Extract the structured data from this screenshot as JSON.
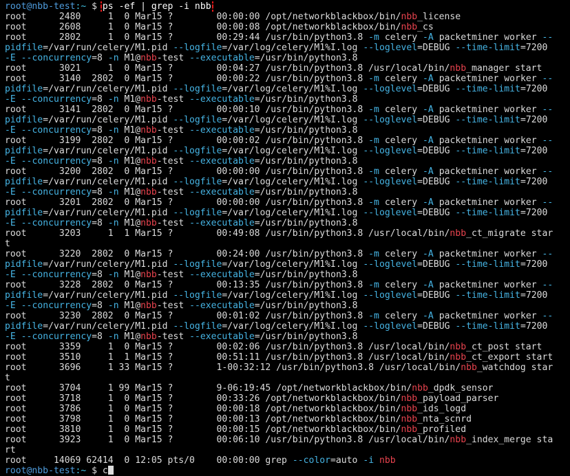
{
  "prompt": {
    "user_host": "root@nbb-test",
    "path": ":~",
    "symbol": " $ ",
    "command": "ps -ef | grep -i nbb"
  },
  "lines": [
    [
      [
        "t",
        "root      2480     1  0 Mar15 ?        00:00:00 /opt/networkblackbox/bin/"
      ],
      [
        "h",
        "nbb"
      ],
      [
        "t",
        "_license"
      ]
    ],
    [
      [
        "t",
        "root      2608     1  0 Mar15 ?        00:00:08 /opt/networkblackbox/bin/"
      ],
      [
        "h",
        "nbb"
      ],
      [
        "t",
        "_cs"
      ]
    ],
    [
      [
        "t",
        "root      2802     1  0 Mar15 ?        00:29:44 /usr/bin/python3.8 "
      ],
      [
        "o",
        "-m"
      ],
      [
        "t",
        " celery "
      ],
      [
        "o",
        "-A"
      ],
      [
        "t",
        " packetminer worker "
      ],
      [
        "o",
        "--"
      ]
    ],
    [
      [
        "o",
        "pidfile"
      ],
      [
        "t",
        "=/var/run/celery/M1.pid "
      ],
      [
        "o",
        "--logfile"
      ],
      [
        "t",
        "=/var/log/celery/M1%I.log "
      ],
      [
        "o",
        "--loglevel"
      ],
      [
        "t",
        "=DEBUG "
      ],
      [
        "o",
        "--time-limit"
      ],
      [
        "t",
        "=7200"
      ]
    ],
    [
      [
        "o",
        "-E"
      ],
      [
        "t",
        " "
      ],
      [
        "o",
        "--concurrency"
      ],
      [
        "t",
        "=8 "
      ],
      [
        "o",
        "-n"
      ],
      [
        "t",
        " M1@"
      ],
      [
        "h",
        "nbb"
      ],
      [
        "t",
        "-test "
      ],
      [
        "o",
        "--executable"
      ],
      [
        "t",
        "=/usr/bin/python3.8"
      ]
    ],
    [
      [
        "t",
        "root      3021     1  0 Mar15 ?        00:04:27 /usr/bin/python3.8 /usr/local/bin/"
      ],
      [
        "h",
        "nbb"
      ],
      [
        "t",
        "_manager start"
      ]
    ],
    [
      [
        "t",
        "root      3140  2802  0 Mar15 ?        00:00:22 /usr/bin/python3.8 "
      ],
      [
        "o",
        "-m"
      ],
      [
        "t",
        " celery "
      ],
      [
        "o",
        "-A"
      ],
      [
        "t",
        " packetminer worker "
      ],
      [
        "o",
        "--"
      ]
    ],
    [
      [
        "o",
        "pidfile"
      ],
      [
        "t",
        "=/var/run/celery/M1.pid "
      ],
      [
        "o",
        "--logfile"
      ],
      [
        "t",
        "=/var/log/celery/M1%I.log "
      ],
      [
        "o",
        "--loglevel"
      ],
      [
        "t",
        "=DEBUG "
      ],
      [
        "o",
        "--time-limit"
      ],
      [
        "t",
        "=7200"
      ]
    ],
    [
      [
        "o",
        "-E"
      ],
      [
        "t",
        " "
      ],
      [
        "o",
        "--concurrency"
      ],
      [
        "t",
        "=8 "
      ],
      [
        "o",
        "-n"
      ],
      [
        "t",
        " M1@"
      ],
      [
        "h",
        "nbb"
      ],
      [
        "t",
        "-test "
      ],
      [
        "o",
        "--executable"
      ],
      [
        "t",
        "=/usr/bin/python3.8"
      ]
    ],
    [
      [
        "t",
        "root      3141  2802  0 Mar15 ?        00:00:10 /usr/bin/python3.8 "
      ],
      [
        "o",
        "-m"
      ],
      [
        "t",
        " celery "
      ],
      [
        "o",
        "-A"
      ],
      [
        "t",
        " packetminer worker "
      ],
      [
        "o",
        "--"
      ]
    ],
    [
      [
        "o",
        "pidfile"
      ],
      [
        "t",
        "=/var/run/celery/M1.pid "
      ],
      [
        "o",
        "--logfile"
      ],
      [
        "t",
        "=/var/log/celery/M1%I.log "
      ],
      [
        "o",
        "--loglevel"
      ],
      [
        "t",
        "=DEBUG "
      ],
      [
        "o",
        "--time-limit"
      ],
      [
        "t",
        "=7200"
      ]
    ],
    [
      [
        "o",
        "-E"
      ],
      [
        "t",
        " "
      ],
      [
        "o",
        "--concurrency"
      ],
      [
        "t",
        "=8 "
      ],
      [
        "o",
        "-n"
      ],
      [
        "t",
        " M1@"
      ],
      [
        "h",
        "nbb"
      ],
      [
        "t",
        "-test "
      ],
      [
        "o",
        "--executable"
      ],
      [
        "t",
        "=/usr/bin/python3.8"
      ]
    ],
    [
      [
        "t",
        "root      3199  2802  0 Mar15 ?        00:00:02 /usr/bin/python3.8 "
      ],
      [
        "o",
        "-m"
      ],
      [
        "t",
        " celery "
      ],
      [
        "o",
        "-A"
      ],
      [
        "t",
        " packetminer worker "
      ],
      [
        "o",
        "--"
      ]
    ],
    [
      [
        "o",
        "pidfile"
      ],
      [
        "t",
        "=/var/run/celery/M1.pid "
      ],
      [
        "o",
        "--logfile"
      ],
      [
        "t",
        "=/var/log/celery/M1%I.log "
      ],
      [
        "o",
        "--loglevel"
      ],
      [
        "t",
        "=DEBUG "
      ],
      [
        "o",
        "--time-limit"
      ],
      [
        "t",
        "=7200"
      ]
    ],
    [
      [
        "o",
        "-E"
      ],
      [
        "t",
        " "
      ],
      [
        "o",
        "--concurrency"
      ],
      [
        "t",
        "=8 "
      ],
      [
        "o",
        "-n"
      ],
      [
        "t",
        " M1@"
      ],
      [
        "h",
        "nbb"
      ],
      [
        "t",
        "-test "
      ],
      [
        "o",
        "--executable"
      ],
      [
        "t",
        "=/usr/bin/python3.8"
      ]
    ],
    [
      [
        "t",
        "root      3200  2802  0 Mar15 ?        00:00:00 /usr/bin/python3.8 "
      ],
      [
        "o",
        "-m"
      ],
      [
        "t",
        " celery "
      ],
      [
        "o",
        "-A"
      ],
      [
        "t",
        " packetminer worker "
      ],
      [
        "o",
        "--"
      ]
    ],
    [
      [
        "o",
        "pidfile"
      ],
      [
        "t",
        "=/var/run/celery/M1.pid "
      ],
      [
        "o",
        "--logfile"
      ],
      [
        "t",
        "=/var/log/celery/M1%I.log "
      ],
      [
        "o",
        "--loglevel"
      ],
      [
        "t",
        "=DEBUG "
      ],
      [
        "o",
        "--time-limit"
      ],
      [
        "t",
        "=7200"
      ]
    ],
    [
      [
        "o",
        "-E"
      ],
      [
        "t",
        " "
      ],
      [
        "o",
        "--concurrency"
      ],
      [
        "t",
        "=8 "
      ],
      [
        "o",
        "-n"
      ],
      [
        "t",
        " M1@"
      ],
      [
        "h",
        "nbb"
      ],
      [
        "t",
        "-test "
      ],
      [
        "o",
        "--executable"
      ],
      [
        "t",
        "=/usr/bin/python3.8"
      ]
    ],
    [
      [
        "t",
        "root      3201  2802  0 Mar15 ?        00:00:00 /usr/bin/python3.8 "
      ],
      [
        "o",
        "-m"
      ],
      [
        "t",
        " celery "
      ],
      [
        "o",
        "-A"
      ],
      [
        "t",
        " packetminer worker "
      ],
      [
        "o",
        "--"
      ]
    ],
    [
      [
        "o",
        "pidfile"
      ],
      [
        "t",
        "=/var/run/celery/M1.pid "
      ],
      [
        "o",
        "--logfile"
      ],
      [
        "t",
        "=/var/log/celery/M1%I.log "
      ],
      [
        "o",
        "--loglevel"
      ],
      [
        "t",
        "=DEBUG "
      ],
      [
        "o",
        "--time-limit"
      ],
      [
        "t",
        "=7200"
      ]
    ],
    [
      [
        "o",
        "-E"
      ],
      [
        "t",
        " "
      ],
      [
        "o",
        "--concurrency"
      ],
      [
        "t",
        "=8 "
      ],
      [
        "o",
        "-n"
      ],
      [
        "t",
        " M1@"
      ],
      [
        "h",
        "nbb"
      ],
      [
        "t",
        "-test "
      ],
      [
        "o",
        "--executable"
      ],
      [
        "t",
        "=/usr/bin/python3.8"
      ]
    ],
    [
      [
        "t",
        "root      3203     1  1 Mar15 ?        00:49:08 /usr/bin/python3.8 /usr/local/bin/"
      ],
      [
        "h",
        "nbb"
      ],
      [
        "t",
        "_ct_migrate star"
      ]
    ],
    [
      [
        "t",
        "t"
      ]
    ],
    [
      [
        "t",
        "root      3220  2802  0 Mar15 ?        00:24:00 /usr/bin/python3.8 "
      ],
      [
        "o",
        "-m"
      ],
      [
        "t",
        " celery "
      ],
      [
        "o",
        "-A"
      ],
      [
        "t",
        " packetminer worker "
      ],
      [
        "o",
        "--"
      ]
    ],
    [
      [
        "o",
        "pidfile"
      ],
      [
        "t",
        "=/var/run/celery/M1.pid "
      ],
      [
        "o",
        "--logfile"
      ],
      [
        "t",
        "=/var/log/celery/M1%I.log "
      ],
      [
        "o",
        "--loglevel"
      ],
      [
        "t",
        "=DEBUG "
      ],
      [
        "o",
        "--time-limit"
      ],
      [
        "t",
        "=7200"
      ]
    ],
    [
      [
        "o",
        "-E"
      ],
      [
        "t",
        " "
      ],
      [
        "o",
        "--concurrency"
      ],
      [
        "t",
        "=8 "
      ],
      [
        "o",
        "-n"
      ],
      [
        "t",
        " M1@"
      ],
      [
        "h",
        "nbb"
      ],
      [
        "t",
        "-test "
      ],
      [
        "o",
        "--executable"
      ],
      [
        "t",
        "=/usr/bin/python3.8"
      ]
    ],
    [
      [
        "t",
        "root      3228  2802  0 Mar15 ?        00:13:35 /usr/bin/python3.8 "
      ],
      [
        "o",
        "-m"
      ],
      [
        "t",
        " celery "
      ],
      [
        "o",
        "-A"
      ],
      [
        "t",
        " packetminer worker "
      ],
      [
        "o",
        "--"
      ]
    ],
    [
      [
        "o",
        "pidfile"
      ],
      [
        "t",
        "=/var/run/celery/M1.pid "
      ],
      [
        "o",
        "--logfile"
      ],
      [
        "t",
        "=/var/log/celery/M1%I.log "
      ],
      [
        "o",
        "--loglevel"
      ],
      [
        "t",
        "=DEBUG "
      ],
      [
        "o",
        "--time-limit"
      ],
      [
        "t",
        "=7200"
      ]
    ],
    [
      [
        "o",
        "-E"
      ],
      [
        "t",
        " "
      ],
      [
        "o",
        "--concurrency"
      ],
      [
        "t",
        "=8 "
      ],
      [
        "o",
        "-n"
      ],
      [
        "t",
        " M1@"
      ],
      [
        "h",
        "nbb"
      ],
      [
        "t",
        "-test "
      ],
      [
        "o",
        "--executable"
      ],
      [
        "t",
        "=/usr/bin/python3.8"
      ]
    ],
    [
      [
        "t",
        "root      3230  2802  0 Mar15 ?        00:01:02 /usr/bin/python3.8 "
      ],
      [
        "o",
        "-m"
      ],
      [
        "t",
        " celery "
      ],
      [
        "o",
        "-A"
      ],
      [
        "t",
        " packetminer worker "
      ],
      [
        "o",
        "--"
      ]
    ],
    [
      [
        "o",
        "pidfile"
      ],
      [
        "t",
        "=/var/run/celery/M1.pid "
      ],
      [
        "o",
        "--logfile"
      ],
      [
        "t",
        "=/var/log/celery/M1%I.log "
      ],
      [
        "o",
        "--loglevel"
      ],
      [
        "t",
        "=DEBUG "
      ],
      [
        "o",
        "--time-limit"
      ],
      [
        "t",
        "=7200"
      ]
    ],
    [
      [
        "o",
        "-E"
      ],
      [
        "t",
        " "
      ],
      [
        "o",
        "--concurrency"
      ],
      [
        "t",
        "=8 "
      ],
      [
        "o",
        "-n"
      ],
      [
        "t",
        " M1@"
      ],
      [
        "h",
        "nbb"
      ],
      [
        "t",
        "-test "
      ],
      [
        "o",
        "--executable"
      ],
      [
        "t",
        "=/usr/bin/python3.8"
      ]
    ],
    [
      [
        "t",
        "root      3359     1  0 Mar15 ?        00:02:06 /usr/bin/python3.8 /usr/local/bin/"
      ],
      [
        "h",
        "nbb"
      ],
      [
        "t",
        "_ct_post start"
      ]
    ],
    [
      [
        "t",
        "root      3510     1  1 Mar15 ?        00:51:11 /usr/bin/python3.8 /usr/local/bin/"
      ],
      [
        "h",
        "nbb"
      ],
      [
        "t",
        "_ct_export start"
      ]
    ],
    [
      [
        "t",
        "root      3696     1 33 Mar15 ?        1-00:32:12 /usr/bin/python3.8 /usr/local/bin/"
      ],
      [
        "h",
        "nbb"
      ],
      [
        "t",
        "_watchdog star"
      ]
    ],
    [
      [
        "t",
        "t"
      ]
    ],
    [
      [
        "t",
        "root      3704     1 99 Mar15 ?        9-06:19:45 /opt/networkblackbox/bin/"
      ],
      [
        "h",
        "nbb"
      ],
      [
        "t",
        "_dpdk_sensor"
      ]
    ],
    [
      [
        "t",
        "root      3718     1  0 Mar15 ?        00:33:26 /opt/networkblackbox/bin/"
      ],
      [
        "h",
        "nbb"
      ],
      [
        "t",
        "_payload_parser"
      ]
    ],
    [
      [
        "t",
        "root      3786     1  0 Mar15 ?        00:00:18 /opt/networkblackbox/bin/"
      ],
      [
        "h",
        "nbb"
      ],
      [
        "t",
        "_ids_logd"
      ]
    ],
    [
      [
        "t",
        "root      3798     1  0 Mar15 ?        00:00:13 /opt/networkblackbox/bin/"
      ],
      [
        "h",
        "nbb"
      ],
      [
        "t",
        "_nta_scnrd"
      ]
    ],
    [
      [
        "t",
        "root      3810     1  0 Mar15 ?        00:00:15 /opt/networkblackbox/bin/"
      ],
      [
        "h",
        "nbb"
      ],
      [
        "t",
        "_profiled"
      ]
    ],
    [
      [
        "t",
        "root      3923     1  0 Mar15 ?        00:06:10 /usr/bin/python3.8 /usr/local/bin/"
      ],
      [
        "h",
        "nbb"
      ],
      [
        "t",
        "_index_merge sta"
      ]
    ],
    [
      [
        "t",
        "rt"
      ]
    ],
    [
      [
        "t",
        "root     14069 62414  0 12:05 pts/0    00:00:00 grep "
      ],
      [
        "o",
        "--color"
      ],
      [
        "t",
        "=auto "
      ],
      [
        "o",
        "-i"
      ],
      [
        "t",
        " "
      ],
      [
        "h",
        "nbb"
      ]
    ]
  ],
  "footer_prompt": {
    "user_host": "root@nbb-test",
    "path": ":~",
    "symbol": " $ ",
    "input": "c"
  }
}
